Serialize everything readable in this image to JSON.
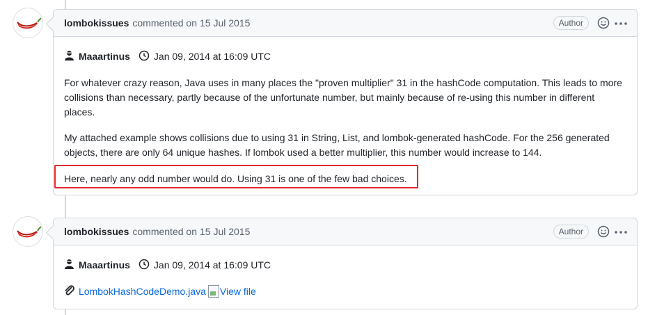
{
  "comments": [
    {
      "author": "lombokissues",
      "commented_prefix": "commented on",
      "date": "15 Jul 2015",
      "badge": "Author",
      "meta": {
        "person": "Maaartinus",
        "timestamp": "Jan 09, 2014 at 16:09 UTC"
      },
      "paragraphs": [
        "For whatever crazy reason, Java uses in many places the \"proven multiplier\" 31 in the hashCode computation. This leads to more collisions than necessary, partly because of the unfortunate number, but mainly because of re-using this number in different places.",
        "My attached example shows collisions due to using 31 in String, List, and lombok-generated hashCode. For the 256 generated objects, there are only 64 unique hashes. If lombok used a better multiplier, this number would increase to 144.",
        "Here, nearly any odd number would do. Using 31 is one of the few bad choices."
      ]
    },
    {
      "author": "lombokissues",
      "commented_prefix": "commented on",
      "date": "15 Jul 2015",
      "badge": "Author",
      "meta": {
        "person": "Maaartinus",
        "timestamp": "Jan 09, 2014 at 16:09 UTC"
      },
      "attachment": {
        "filename": "LombokHashCodeDemo.java",
        "view_alt": "View file"
      }
    }
  ],
  "colors": {
    "highlight": "#e5272d",
    "link": "#0969da",
    "header_bg": "#f6f8fa",
    "border": "#d0d7de"
  },
  "icons": [
    "avatar-chili",
    "person-icon",
    "clock-icon",
    "smiley-icon",
    "kebab-icon",
    "paperclip-icon",
    "broken-image-icon"
  ]
}
